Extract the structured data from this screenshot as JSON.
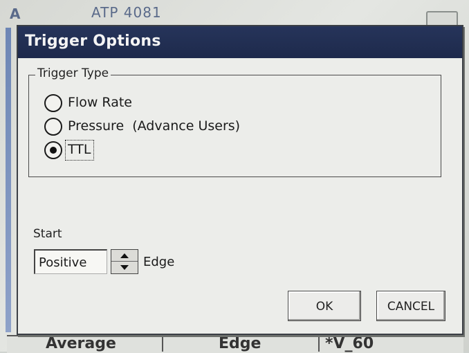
{
  "background": {
    "app_title": "ATP 4081",
    "app_letter": "A",
    "bottom_cells": [
      "Average",
      "Edge",
      "*V_60"
    ]
  },
  "dialog": {
    "title": "Trigger Options",
    "trigger_type": {
      "legend": "Trigger Type",
      "options": [
        {
          "label": "Flow Rate",
          "selected": false
        },
        {
          "label": "Pressure  (Advance Users)",
          "selected": false
        },
        {
          "label": "TTL",
          "selected": true
        }
      ]
    },
    "start": {
      "label": "Start",
      "edge_value": "Positive",
      "edge_suffix": "Edge"
    },
    "buttons": {
      "ok": "OK",
      "cancel": "CANCEL"
    }
  },
  "colors": {
    "titlebar": "#1e2a4c",
    "dialog_bg": "#ecedea"
  },
  "icons": {
    "spinner_up": "triangle-up-icon",
    "spinner_down": "triangle-down-icon"
  }
}
